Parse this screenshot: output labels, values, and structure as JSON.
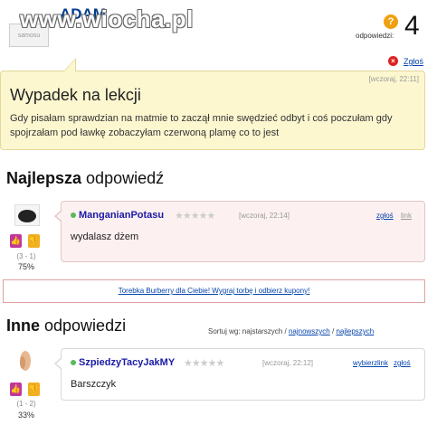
{
  "watermark": "www.wiocha.pl",
  "question": {
    "author": "ADAM",
    "avatar_label": "samosu",
    "answers_label": "odpowiedzi:",
    "answers_count": "4",
    "report_label": "Zgłoś",
    "time": "[wczoraj, 22:11]",
    "title": "Wypadek na lekcji",
    "body": "Gdy pisałam sprawdzian na matmie to zaczął mnie swędzieć odbyt i coś poczułam gdy spojrzałam pod ławkę zobaczyłam czerwoną plamę co to jest"
  },
  "best": {
    "heading_bold": "Najlepsza",
    "heading_rest": " odpowiedź",
    "user": "ManganianPotasu",
    "time": "[wczoraj, 22:14]",
    "report_link": "zgłoś",
    "link": "link",
    "text": "wydalasz dżem",
    "votes": "(3 - 1)",
    "percent": "75%",
    "stars": "★★★★★"
  },
  "ad": {
    "text": "Torebka Burberry dla Ciebie! Wygraj torbę i odbierz kupony!"
  },
  "others": {
    "heading_bold": "Inne",
    "heading_rest": " odpowiedzi",
    "sort_label": "Sortuj wg: najstarszych /",
    "sort_newest": "najnowszych",
    "sort_sep": "/",
    "sort_best": "najlepszych",
    "items": [
      {
        "user": "SzpiedzyTacyJakMY",
        "time": "[wczoraj, 22:12]",
        "choose": "wybierz",
        "link": "link",
        "report_link": "zgłoś",
        "text": "Barszczyk",
        "votes": "(1 - 2)",
        "percent": "33%",
        "stars": "★★★★★"
      }
    ]
  },
  "colors": {
    "question_bg": "#fdf7d0",
    "best_bg": "#fdf0f0",
    "username": "#1a1aa6",
    "link": "#0645ad",
    "vote_up": "#c2389a",
    "vote_down": "#f0b020"
  }
}
